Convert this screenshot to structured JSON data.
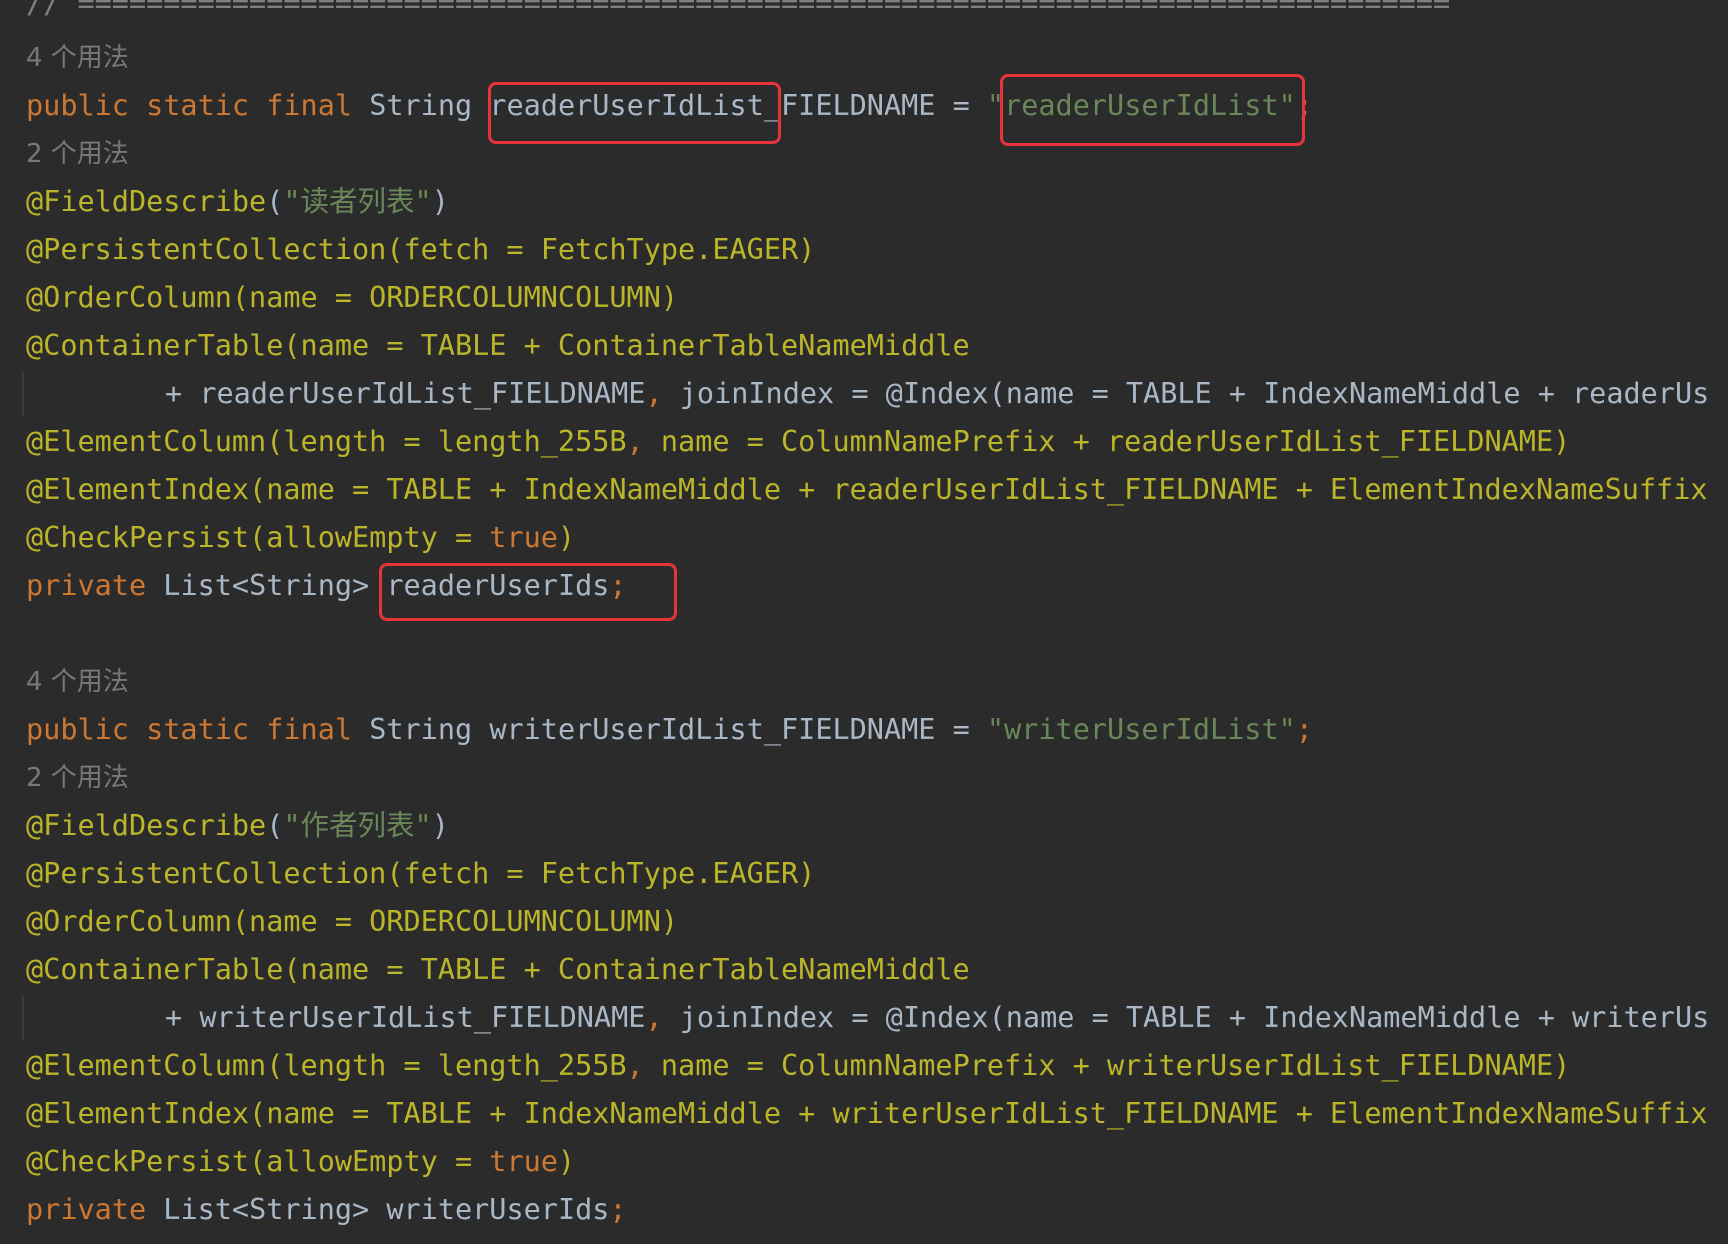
{
  "editor": {
    "separator": "// ================================================================================",
    "blocks": [
      {
        "const_hint": "4 个用法",
        "const_decl": {
          "mods": "public static final",
          "type": "String",
          "name": "readerUserIdList_FIELDNAME",
          "eq": " = ",
          "value": "\"readerUserIdList\"",
          "semi": ";"
        },
        "field_hint": "2 个用法",
        "describe": {
          "ann": "@FieldDescribe",
          "open": "(",
          "value": "\"读者列表\"",
          "close": ")"
        },
        "persistent": "@PersistentCollection(fetch = FetchType.EAGER)",
        "order": "@OrderColumn(name = ORDERCOLUMNCOLUMN)",
        "container": "@ContainerTable(name = TABLE + ContainerTableNameMiddle",
        "container_cont_a": "+ readerUserIdList_FIELDNAME",
        "container_cont_comma": ",",
        "container_cont_b": " joinIndex = @Index(name = TABLE + IndexNameMiddle + readerUs",
        "element_col_a": "@ElementColumn(length = length_255B",
        "element_col_comma": ",",
        "element_col_b": " name = ColumnNamePrefix + readerUserIdList_FIELDNAME)",
        "element_idx": "@ElementIndex(name = TABLE + IndexNameMiddle + readerUserIdList_FIELDNAME + ElementIndexNameSuffix",
        "check_a": "@CheckPersist(allowEmpty = ",
        "check_val": "true",
        "check_b": ")",
        "field_decl": {
          "mod": "private",
          "type": "List<String>",
          "name": "readerUserIds",
          "semi": ";"
        }
      },
      {
        "const_hint": "4 个用法",
        "const_decl": {
          "mods": "public static final",
          "type": "String",
          "name": "writerUserIdList_FIELDNAME",
          "eq": " = ",
          "value": "\"writerUserIdList\"",
          "semi": ";"
        },
        "field_hint": "2 个用法",
        "describe": {
          "ann": "@FieldDescribe",
          "open": "(",
          "value": "\"作者列表\"",
          "close": ")"
        },
        "persistent": "@PersistentCollection(fetch = FetchType.EAGER)",
        "order": "@OrderColumn(name = ORDERCOLUMNCOLUMN)",
        "container": "@ContainerTable(name = TABLE + ContainerTableNameMiddle",
        "container_cont_a": "+ writerUserIdList_FIELDNAME",
        "container_cont_comma": ",",
        "container_cont_b": " joinIndex = @Index(name = TABLE + IndexNameMiddle + writerUs",
        "element_col_a": "@ElementColumn(length = length_255B",
        "element_col_comma": ",",
        "element_col_b": " name = ColumnNamePrefix + writerUserIdList_FIELDNAME)",
        "element_idx": "@ElementIndex(name = TABLE + IndexNameMiddle + writerUserIdList_FIELDNAME + ElementIndexNameSuffix",
        "check_a": "@CheckPersist(allowEmpty = ",
        "check_val": "true",
        "check_b": ")",
        "field_decl": {
          "mod": "private",
          "type": "List<String>",
          "name": "writerUserIds",
          "semi": ";"
        }
      }
    ],
    "highlight_color": "#e8323d"
  }
}
